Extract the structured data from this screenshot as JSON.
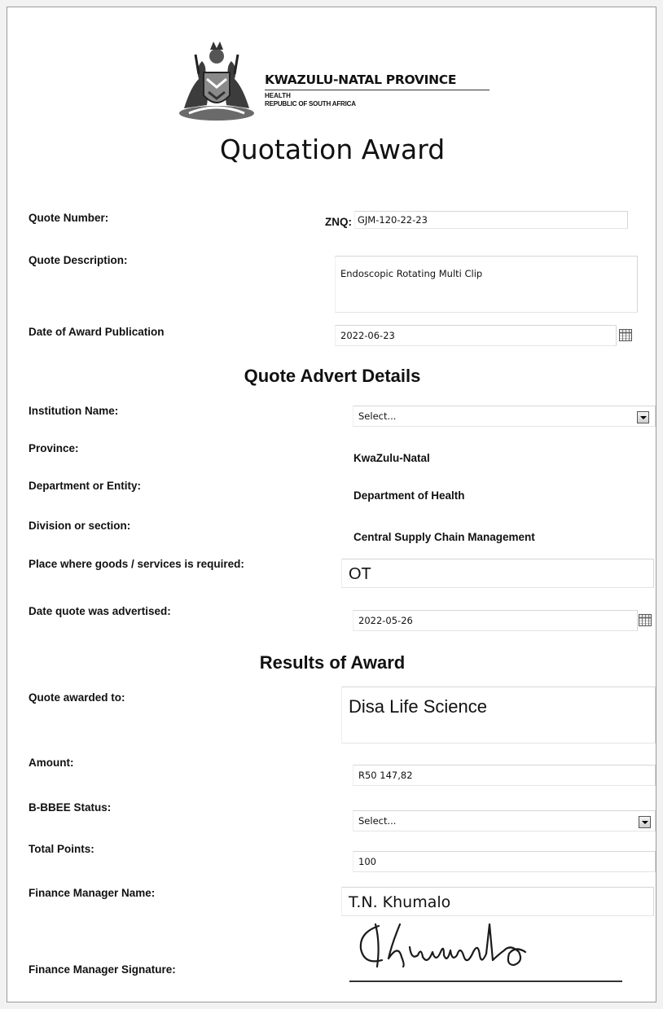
{
  "header": {
    "org_title": "KWAZULU-NATAL PROVINCE",
    "org_dept": "HEALTH",
    "org_country": "REPUBLIC OF SOUTH AFRICA",
    "crest_icon": "coat-of-arms-icon"
  },
  "form_title": "Quotation Award",
  "quote": {
    "number_label": "Quote Number:",
    "number_prefix": "ZNQ:",
    "number_value": "GJM-120-22-23",
    "description_label": "Quote Description:",
    "description_value": "Endoscopic Rotating Multi Clip",
    "award_date_label": "Date of Award Publication",
    "award_date_value": "2022-06-23"
  },
  "advert": {
    "section_title": "Quote Advert Details",
    "institution_label": "Institution Name:",
    "institution_value": "Select...",
    "province_label": "Province:",
    "province_value": "KwaZulu-Natal",
    "department_label": "Department or Entity:",
    "department_value": "Department of Health",
    "division_label": "Division or section:",
    "division_value": "Central Supply Chain Management",
    "place_label": "Place where goods /  services is required:",
    "place_value": "OT",
    "advertised_label": "Date quote was advertised:",
    "advertised_value": "2022-05-26"
  },
  "results": {
    "section_title": "Results of Award",
    "awarded_label": "Quote awarded to:",
    "awarded_value": "Disa Life Science",
    "amount_label": "Amount:",
    "amount_value": "R50 147,82",
    "bbbee_label": "B-BBEE Status:",
    "bbbee_value": "Select...",
    "points_label": "Total Points:",
    "points_value": "100",
    "manager_label": "Finance Manager Name:",
    "manager_value": "T.N. Khumalo",
    "signature_label": "Finance Manager Signature:",
    "signature_text": "Khumalo"
  }
}
